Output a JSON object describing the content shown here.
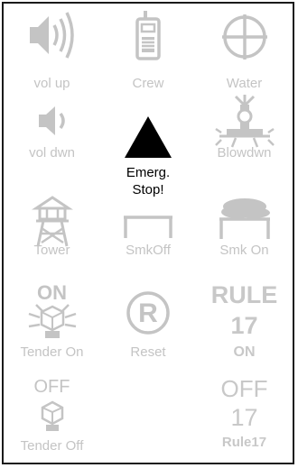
{
  "colors": {
    "inactive": "#c4c4c4",
    "active": "#000000",
    "border": "#1a1a1a"
  },
  "buttons": {
    "vol_up": {
      "label": "vol up",
      "icon": "speaker-loud-icon"
    },
    "crew": {
      "label": "Crew",
      "icon": "radio-icon"
    },
    "water": {
      "label": "Water",
      "icon": "crosshair-icon"
    },
    "vol_dwn": {
      "label": "vol dwn",
      "icon": "speaker-quiet-icon"
    },
    "emerg_stop": {
      "label_line1": "Emerg.",
      "label_line2": "Stop!",
      "icon": "triangle-icon"
    },
    "blowdwn": {
      "label": "Blowdwn",
      "icon": "blowdown-valve-icon"
    },
    "tower": {
      "label": "Tower",
      "icon": "water-tower-icon"
    },
    "smk_off": {
      "label": "SmkOff",
      "icon": "bench-icon"
    },
    "smk_on": {
      "label": "Smk On",
      "icon": "smoke-cloud-icon"
    },
    "tender_on": {
      "label": "Tender On",
      "badge": "ON",
      "icon": "tender-light-on-icon"
    },
    "reset": {
      "label": "Reset",
      "icon": "registered-r-icon"
    },
    "rule17_on": {
      "line1": "RULE",
      "line2": "17",
      "line3": "ON"
    },
    "tender_off": {
      "label": "Tender Off",
      "badge": "OFF",
      "icon": "tender-light-off-icon"
    },
    "rule17_off": {
      "line1": "OFF",
      "line2": "17",
      "line3": "Rule17"
    }
  }
}
